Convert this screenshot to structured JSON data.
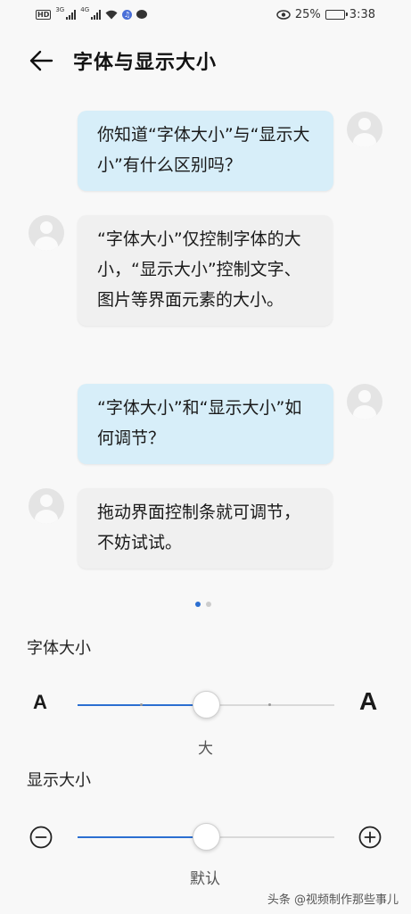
{
  "status_bar": {
    "hd": "HD",
    "net1": "3G",
    "net2": "4G",
    "app_badge": "♫",
    "battery_pct": "25%",
    "battery_level": 0.25,
    "time": "3:38",
    "icons": [
      "eye-icon",
      "wifi-icon",
      "battery-icon"
    ]
  },
  "header": {
    "title": "字体与显示大小"
  },
  "chat": {
    "messages": [
      {
        "role": "me",
        "text": "你知道“字体大小”与“显示大小”有什么区别吗？"
      },
      {
        "role": "other",
        "text": "“字体大小”仅控制字体的大小，“显示大小”控制文字、图片等界面元素的大小。"
      },
      {
        "role": "me",
        "text": "“字体大小”和“显示大小”如何调节？"
      },
      {
        "role": "other",
        "text": "拖动界面控制条就可调节，不妨试试。"
      }
    ]
  },
  "pager": {
    "count": 2,
    "active": 0,
    "active_color": "#2c6fd1",
    "inactive_color": "#cccccc"
  },
  "font_size": {
    "label": "字体大小",
    "small_a": "A",
    "large_a": "A",
    "value": "大",
    "level": 0.5
  },
  "display_size": {
    "label": "显示大小",
    "value": "默认",
    "level": 0.5
  },
  "watermark": "头条 @视频制作那些事儿",
  "colors": {
    "accent": "#2c6fd1",
    "bubble_me": "#d7eef9",
    "bubble_other": "#f0f0f0"
  }
}
